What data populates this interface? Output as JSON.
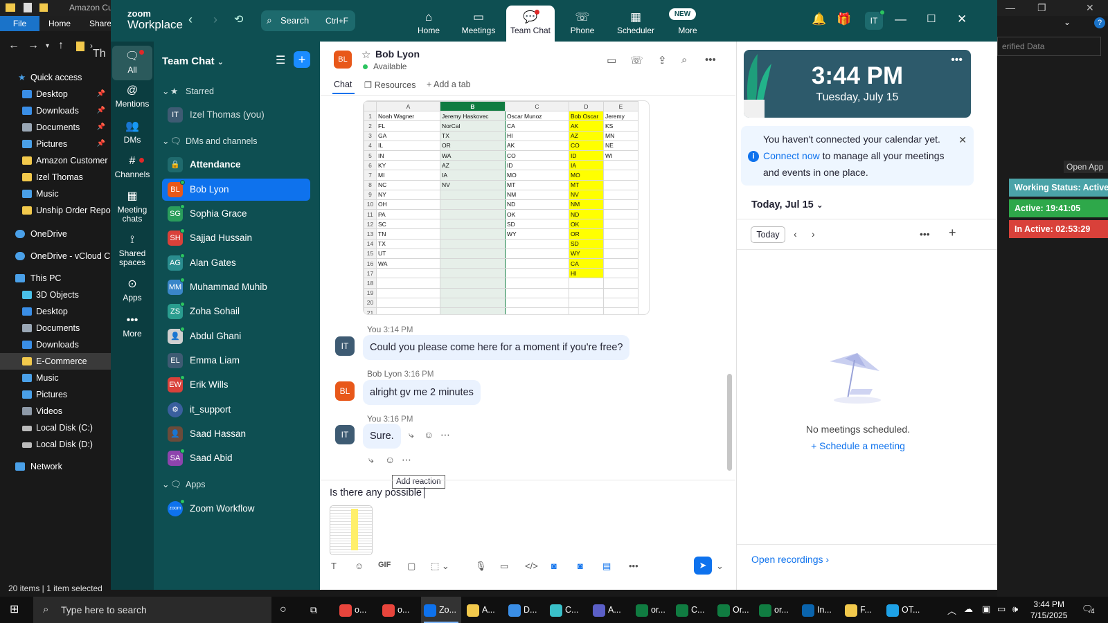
{
  "explorer": {
    "title": "Amazon Cu",
    "ribbon": {
      "file": "File",
      "home": "Home",
      "share": "Share"
    },
    "breadcrumb_fragment": "Th",
    "quick_access": "Quick access",
    "tree": [
      {
        "label": "Desktop",
        "pinned": true,
        "color": "#3a8ee6"
      },
      {
        "label": "Downloads",
        "pinned": true,
        "color": "#3a8ee6"
      },
      {
        "label": "Documents",
        "pinned": true,
        "color": "#9aa7b5"
      },
      {
        "label": "Pictures",
        "pinned": true,
        "color": "#4aa0e8"
      },
      {
        "label": "Amazon Customer",
        "pinned": false,
        "color": "#f2c94c"
      },
      {
        "label": "Izel Thomas",
        "pinned": false,
        "color": "#f2c94c"
      },
      {
        "label": "Music",
        "pinned": false,
        "color": "#4aa0e8"
      },
      {
        "label": "Unship Order Repor",
        "pinned": false,
        "color": "#f2c94c"
      }
    ],
    "onedrive": "OneDrive",
    "onedrive_vcloud": "OneDrive - vCloud Cl",
    "this_pc": "This PC",
    "pc_items": [
      "3D Objects",
      "Desktop",
      "Documents",
      "Downloads",
      "E-Commerce",
      "Music",
      "Pictures",
      "Videos",
      "Local Disk (C:)",
      "Local Disk (D:)"
    ],
    "network": "Network",
    "status": "20 items  |  1 item selected",
    "field_fragment": "erified Data",
    "open_app": "Open App"
  },
  "work_status": {
    "status": "Working Status: Active",
    "active": "Active: 19:41:05",
    "inactive": "In Active: 02:53:29",
    "colors": {
      "status": "#4ba3a8",
      "active": "#2ea84a",
      "inactive": "#d9413a"
    }
  },
  "zoom": {
    "logo_top": "zoom",
    "logo_bottom": "Workplace",
    "search": {
      "label": "Search",
      "shortcut": "Ctrl+F"
    },
    "tabs": [
      {
        "label": "Home",
        "icon": "home-icon"
      },
      {
        "label": "Meetings",
        "icon": "video-icon"
      },
      {
        "label": "Team Chat",
        "icon": "chat-icon",
        "active": true
      },
      {
        "label": "Phone",
        "icon": "phone-icon"
      },
      {
        "label": "Scheduler",
        "icon": "calendar-icon"
      },
      {
        "label": "More",
        "icon": "more-icon",
        "badge": "NEW"
      }
    ],
    "user_initials": "IT",
    "rail": [
      {
        "label": "All",
        "icon": "chat-bubble-icon"
      },
      {
        "label": "Mentions",
        "icon": "at-icon"
      },
      {
        "label": "DMs",
        "icon": "people-icon"
      },
      {
        "label": "Channels",
        "icon": "hash-icon"
      },
      {
        "label": "Meeting chats",
        "icon": "calendar-icon"
      },
      {
        "label": "Shared spaces",
        "icon": "shared-icon"
      },
      {
        "label": "Apps",
        "icon": "apps-icon"
      },
      {
        "label": "More",
        "icon": "more-icon"
      }
    ],
    "sidebar": {
      "title": "Team Chat",
      "starred": "Starred",
      "starred_item": {
        "initials": "IT",
        "name": "Izel Thomas (you)",
        "color": "#3e5b73"
      },
      "dms_section": "DMs and channels",
      "items": [
        {
          "initials": "",
          "name": "Attendance",
          "color": "#1f6a6d",
          "bold": true
        },
        {
          "initials": "BL",
          "name": "Bob Lyon",
          "color": "#e8581a",
          "active": true
        },
        {
          "initials": "SG",
          "name": "Sophia Grace",
          "color": "#2a9d5c"
        },
        {
          "initials": "SH",
          "name": "Sajjad Hussain",
          "color": "#d9413a"
        },
        {
          "initials": "AG",
          "name": "Alan Gates",
          "color": "#2a8d8f"
        },
        {
          "initials": "MM",
          "name": "Muhammad Muhib",
          "color": "#3a86c9"
        },
        {
          "initials": "ZS",
          "name": "Zoha Sohail",
          "color": "#2a9d8f"
        },
        {
          "initials": "",
          "name": "Abdul Ghani",
          "color": "#d0d0d0"
        },
        {
          "initials": "EL",
          "name": "Emma Liam",
          "color": "#3e5b73"
        },
        {
          "initials": "EW",
          "name": "Erik Wills",
          "color": "#d9413a"
        },
        {
          "initials": "",
          "name": "it_support",
          "color": "#3a5f9e"
        },
        {
          "initials": "",
          "name": "Saad Hassan",
          "color": "#6b4b3a"
        },
        {
          "initials": "SA",
          "name": "Saad Abid",
          "color": "#8e44ad"
        }
      ],
      "apps_section": "Apps",
      "apps_item": {
        "initials": "zoom",
        "name": "Zoom Workflow",
        "color": "#0e72ed"
      }
    },
    "chat": {
      "contact": {
        "initials": "BL",
        "name": "Bob Lyon",
        "status": "Available"
      },
      "tabs": [
        "Chat",
        "Resources",
        "Add a tab"
      ],
      "sheet": {
        "columns": [
          "A",
          "B",
          "C",
          "D",
          "E"
        ],
        "rows": [
          [
            "Noah Wagner",
            "Jeremy Haskovec",
            "Oscar Munoz",
            "Bob Oscar",
            "Jeremy"
          ],
          [
            "FL",
            "NorCal",
            "CA",
            "AK",
            "KS"
          ],
          [
            "GA",
            "TX",
            "HI",
            "AZ",
            "MN"
          ],
          [
            "IL",
            "OR",
            "AK",
            "CO",
            "NE"
          ],
          [
            "IN",
            "WA",
            "CO",
            "ID",
            "WI"
          ],
          [
            "KY",
            "AZ",
            "ID",
            "IA",
            ""
          ],
          [
            "MI",
            "IA",
            "MO",
            "MO",
            ""
          ],
          [
            "NC",
            "NV",
            "MT",
            "MT",
            ""
          ],
          [
            "NY",
            "",
            "NM",
            "NV",
            ""
          ],
          [
            "OH",
            "",
            "ND",
            "NM",
            ""
          ],
          [
            "PA",
            "",
            "OK",
            "ND",
            ""
          ],
          [
            "SC",
            "",
            "SD",
            "OK",
            ""
          ],
          [
            "TN",
            "",
            "WY",
            "OR",
            ""
          ],
          [
            "TX",
            "",
            "",
            "SD",
            ""
          ],
          [
            "UT",
            "",
            "",
            "WY",
            ""
          ],
          [
            "WA",
            "",
            "",
            "CA",
            ""
          ],
          [
            "",
            "",
            "",
            "HI",
            ""
          ],
          [
            "",
            "",
            "",
            "",
            ""
          ],
          [
            "",
            "",
            "",
            "",
            ""
          ],
          [
            "",
            "",
            "",
            "",
            ""
          ],
          [
            "",
            "",
            "",
            "",
            ""
          ]
        ]
      },
      "messages": [
        {
          "sender": "You",
          "time": "3:14 PM",
          "initials": "IT",
          "color": "#3e5b73",
          "text": "Could you please come here for a moment if you're free?"
        },
        {
          "sender": "Bob Lyon",
          "time": "3:16 PM",
          "initials": "BL",
          "color": "#e8581a",
          "text": "alright gv me 2 minutes"
        },
        {
          "sender": "You",
          "time": "3:16 PM",
          "initials": "IT",
          "color": "#3e5b73",
          "text": "Sure."
        }
      ],
      "tooltip": "Add reaction",
      "composer_text": "Is there any possible",
      "composer_tools": [
        "text-format-icon",
        "emoji-icon",
        "GIF",
        "file-icon",
        "screenshot-icon",
        "mic-icon",
        "video-clip-icon",
        "code-icon",
        "whiteboard-icon",
        "notes-icon",
        "docs-icon",
        "more-icon"
      ]
    },
    "right_panel": {
      "time": "3:44 PM",
      "date": "Tuesday, July 15",
      "notice_pre": "You haven't connected your calendar yet.",
      "notice_link": "Connect now",
      "notice_post": "to manage all your meetings and events in one place.",
      "cal_header": "Today, Jul 15",
      "today_btn": "Today",
      "no_meetings": "No meetings scheduled.",
      "schedule": "Schedule a meeting",
      "open_recordings": "Open recordings"
    }
  },
  "taskbar": {
    "search_placeholder": "Type here to search",
    "items": [
      {
        "label": "o...",
        "icon": "chrome-icon"
      },
      {
        "label": "o...",
        "icon": "chrome-icon"
      },
      {
        "label": "Zo...",
        "icon": "zoom-icon",
        "active": true
      },
      {
        "label": "A...",
        "icon": "folder-icon"
      },
      {
        "label": "D...",
        "icon": "download-icon"
      },
      {
        "label": "C...",
        "icon": "app-icon"
      },
      {
        "label": "A...",
        "icon": "teams-icon"
      },
      {
        "label": "or...",
        "icon": "excel-icon"
      },
      {
        "label": "C...",
        "icon": "excel-icon"
      },
      {
        "label": "Or...",
        "icon": "excel-icon"
      },
      {
        "label": "or...",
        "icon": "excel-icon"
      },
      {
        "label": "In...",
        "icon": "outlook-icon"
      },
      {
        "label": "F...",
        "icon": "mail-icon"
      },
      {
        "label": "OT...",
        "icon": "edge-icon"
      }
    ],
    "time": "3:44 PM",
    "date": "7/15/2025",
    "notifications": "4"
  }
}
